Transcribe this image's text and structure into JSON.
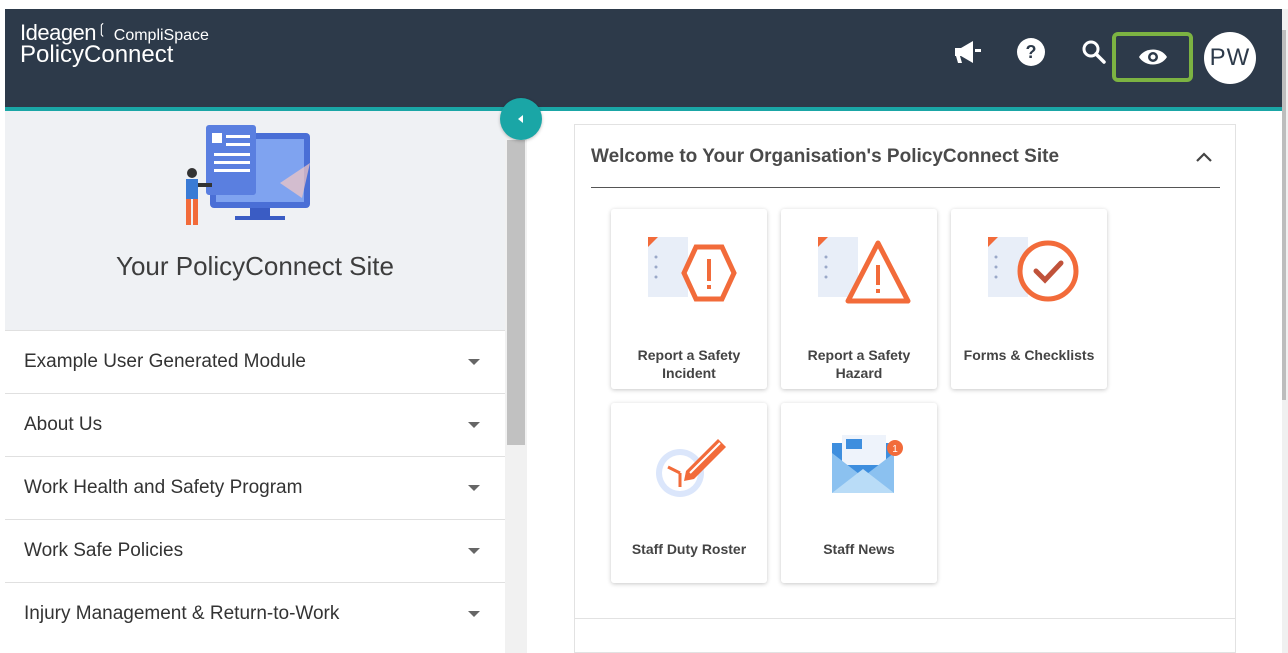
{
  "header": {
    "brand": "Ideagen",
    "brand_sub": "CompliSpace",
    "product": "PolicyConnect",
    "avatar_initials": "PW",
    "eye_highlight_color": "#7cb342",
    "bar_color": "#2d3a4a",
    "accent_color": "#1aa6a6"
  },
  "sidebar": {
    "site_title": "Your PolicyConnect Site",
    "items": [
      {
        "label": "Example User Generated Module"
      },
      {
        "label": "About Us"
      },
      {
        "label": "Work Health and Safety Program"
      },
      {
        "label": "Work Safe Policies"
      },
      {
        "label": "Injury Management & Return-to-Work"
      }
    ]
  },
  "panel": {
    "title": "Welcome to Your Organisation's PolicyConnect Site",
    "tiles": [
      {
        "label": "Report a Safety Incident",
        "icon": "hexagon-alert-icon"
      },
      {
        "label": "Report a Safety Hazard",
        "icon": "triangle-warning-icon"
      },
      {
        "label": "Forms & Checklists",
        "icon": "check-circle-icon"
      },
      {
        "label": "Staff Duty Roster",
        "icon": "clock-pencil-icon"
      },
      {
        "label": "Staff News",
        "icon": "envelope-icon",
        "badge": "1"
      }
    ]
  }
}
